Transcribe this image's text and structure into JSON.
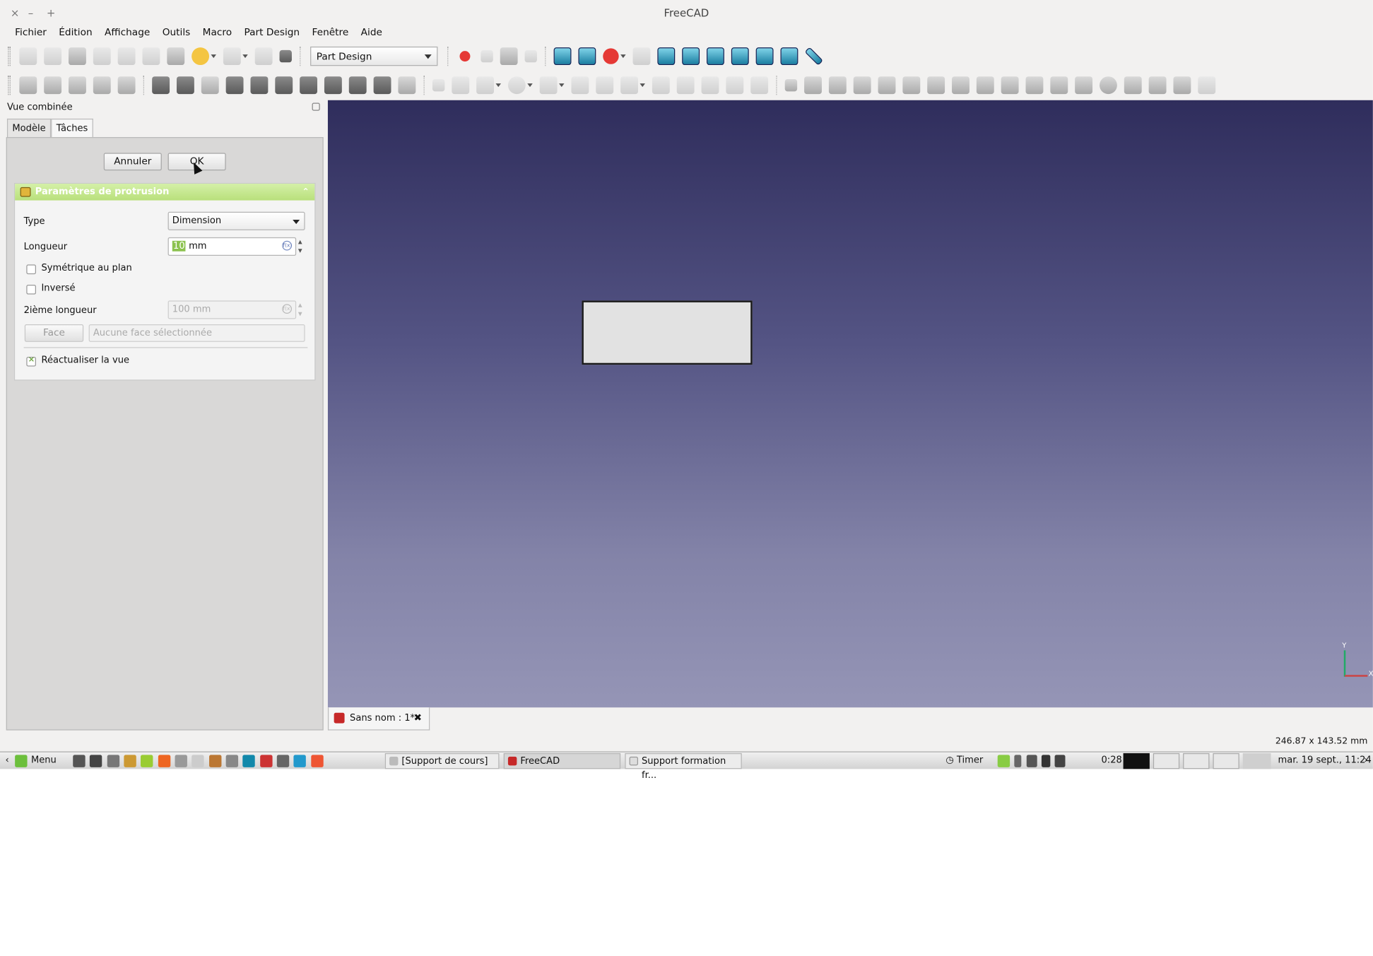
{
  "window": {
    "title": "FreeCAD",
    "controls": [
      "×",
      "–",
      "+"
    ]
  },
  "menu": [
    "Fichier",
    "Édition",
    "Affichage",
    "Outils",
    "Macro",
    "Part Design",
    "Fenêtre",
    "Aide"
  ],
  "workbench": {
    "selected": "Part Design"
  },
  "panel": {
    "title": "Vue combinée",
    "tabs": [
      "Modèle",
      "Tâches"
    ],
    "active_tab": "Tâches",
    "cancel_label": "Annuler",
    "ok_label": "OK",
    "section_title": "Paramètres de protrusion",
    "type_label": "Type",
    "type_value": "Dimension",
    "length_label": "Longueur",
    "length_selected": "10",
    "length_unit": "mm",
    "symmetric_label": "Symétrique au plan",
    "symmetric_checked": false,
    "reversed_label": "Inversé",
    "reversed_checked": false,
    "second_length_label": "2ième longueur",
    "second_length_value": "100 mm",
    "face_button": "Face",
    "face_placeholder": "Aucune face sélectionnée",
    "refresh_label": "Réactualiser la vue",
    "refresh_checked": true
  },
  "document_tab": {
    "label": "Sans nom : 1*",
    "close": "✖"
  },
  "status_dimensions": "246.87 x 143.52 mm",
  "taskbar": {
    "menu_label": "Menu",
    "windows": [
      "[Support de cours]",
      "FreeCAD",
      "Support formation fr..."
    ],
    "timer_label": "Timer",
    "battery_time": "0:28",
    "clock": "mar. 19 sept., 11:24"
  },
  "colors": {
    "viewport_top": "#2f2d5c",
    "viewport_bottom": "#9595b6",
    "section_header": "#b9e07b",
    "selection": "#8cc24f"
  }
}
